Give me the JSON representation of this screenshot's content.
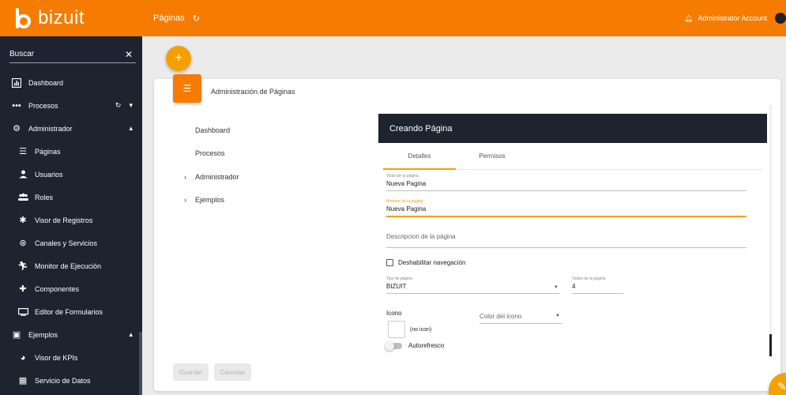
{
  "app": {
    "logo_text": "bizuit"
  },
  "topbar": {
    "title": "Páginas",
    "user": "Administrator Account"
  },
  "search": {
    "placeholder": "Buscar"
  },
  "sidebar": {
    "items": [
      {
        "label": "Dashboard",
        "icon": "dashboard-icon"
      },
      {
        "label": "Procesos",
        "icon": "dots-icon"
      },
      {
        "label": "Administrador",
        "icon": "gear-icon"
      },
      {
        "label": "Páginas",
        "icon": "list-icon"
      },
      {
        "label": "Usuarios",
        "icon": "user-icon"
      },
      {
        "label": "Roles",
        "icon": "group-icon"
      },
      {
        "label": "Visor de Registros",
        "icon": "bug-icon"
      },
      {
        "label": "Canales y Servicios",
        "icon": "chip-icon"
      },
      {
        "label": "Monitor de Ejecución",
        "icon": "runner-icon"
      },
      {
        "label": "Componentes",
        "icon": "puzzle-icon"
      },
      {
        "label": "Editor de Formularios",
        "icon": "monitor-icon"
      },
      {
        "label": "Ejemplos",
        "icon": "folder-icon"
      },
      {
        "label": "Visor de KPIs",
        "icon": "pie-icon"
      },
      {
        "label": "Servicio de Datos",
        "icon": "table-icon"
      }
    ]
  },
  "card": {
    "title": "Administración de Páginas"
  },
  "tree": {
    "items": [
      {
        "label": "Dashboard"
      },
      {
        "label": "Procesos"
      },
      {
        "label": "Administrador"
      },
      {
        "label": "Ejemplos"
      }
    ]
  },
  "buttons": {
    "save": "Guardar",
    "cancel": "Cancelar"
  },
  "form": {
    "header": "Creando Página",
    "tabs": [
      "Detalles",
      "Permisos"
    ],
    "titulo": {
      "label": "Titulo de la página",
      "value": "Nueva Pagina"
    },
    "nombre": {
      "label": "Nombre de la página",
      "value": "Nueva Pagina"
    },
    "descripcion": {
      "placeholder": "Descripcion de la página"
    },
    "deshabilitar": "Deshabilitar navegación",
    "tipo": {
      "label": "Tipo de página",
      "value": "BIZUIT"
    },
    "orden": {
      "label": "Orden de la página",
      "value": "4"
    },
    "icono": {
      "label": "Icono",
      "value": "(no icon)"
    },
    "color": {
      "placeholder": "Color del icono"
    },
    "autorefresco": "Autorefresco"
  },
  "colors": {
    "accent": "#f57c00",
    "sidebar": "#1e2330",
    "highlight": "#f5a000"
  }
}
